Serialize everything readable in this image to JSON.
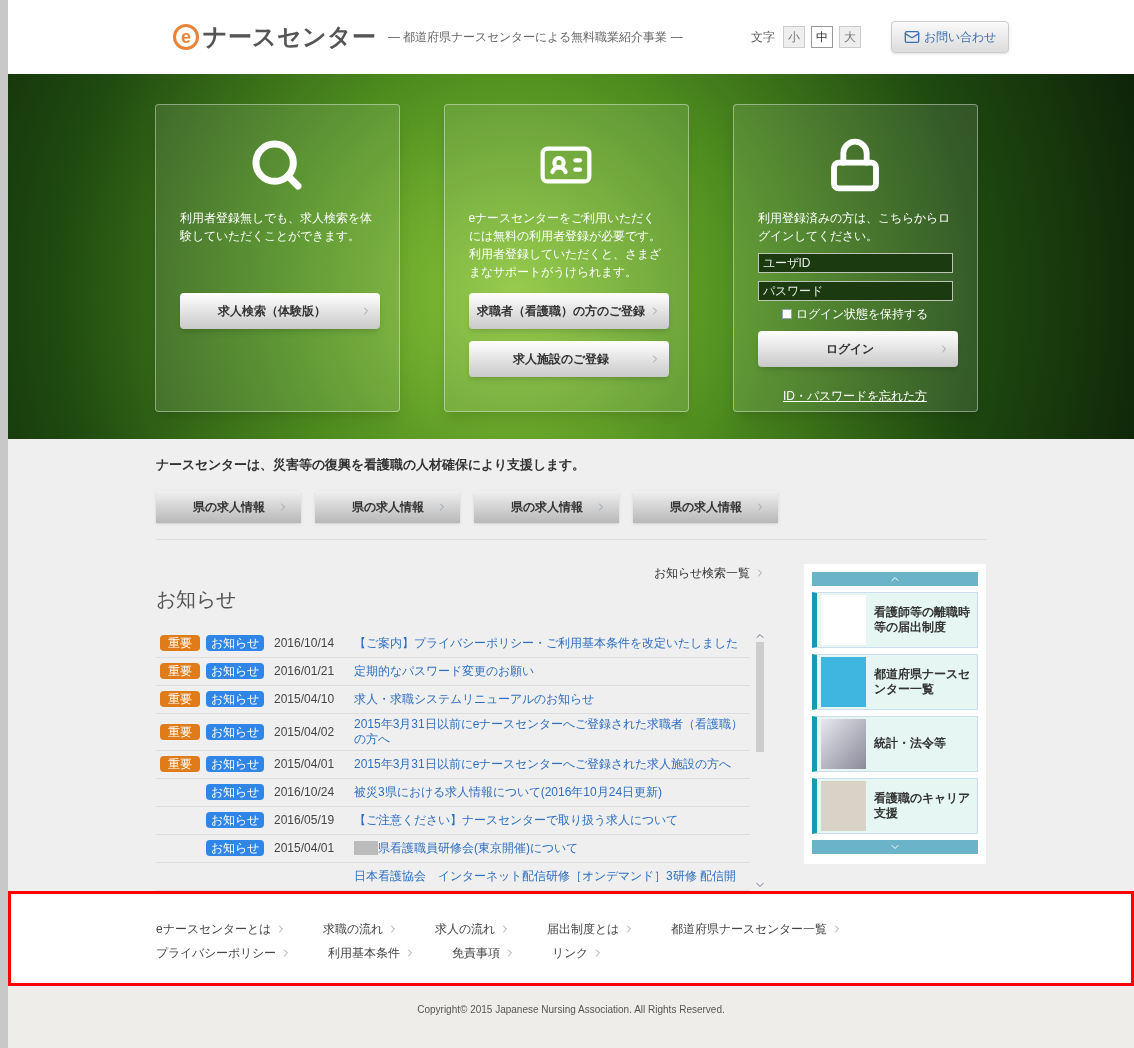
{
  "header": {
    "logo_letter": "e",
    "logo_text": "ナースセンター",
    "tagline": "― 都道府県ナースセンターによる無料職業紹介事業 ―",
    "font_size_label": "文字",
    "font_sizes": [
      {
        "label": "小",
        "selected": false
      },
      {
        "label": "中",
        "selected": true
      },
      {
        "label": "大",
        "selected": false
      }
    ],
    "contact_button": "お問い合わせ"
  },
  "hero": {
    "cards": [
      {
        "kind": "search",
        "text": "利用者登録無しでも、求人検索を体験していただくことができます。",
        "buttons": [
          "求人検索（体験版）"
        ]
      },
      {
        "kind": "register",
        "text": "eナースセンターをご利用いただくには無料の利用者登録が必要です。利用者登録していただくと、さまざまなサポートがうけられます。",
        "buttons": [
          "求職者（看護職）の方のご登録",
          "求人施設のご登録"
        ]
      },
      {
        "kind": "login",
        "text": "利用登録済みの方は、こちらからログインしてください。",
        "user_placeholder": "ユーザID",
        "password_placeholder": "パスワード",
        "remember": {
          "label": "ログイン状態を保持する",
          "checked": false
        },
        "buttons": [
          "ログイン"
        ],
        "forgot_link": "ID・パスワードを忘れた方"
      }
    ]
  },
  "headline": "ナースセンターは、災害等の復興を看護職の人材確保により支援します。",
  "prefecture_buttons": [
    "県の求人情報",
    "県の求人情報",
    "県の求人情報",
    "県の求人情報"
  ],
  "news": {
    "title": "お知らせ",
    "list_link": "お知らせ検索一覧",
    "rows": [
      {
        "tags": [
          {
            "kind": "important",
            "label": "重要"
          },
          {
            "kind": "notice",
            "label": "お知らせ"
          }
        ],
        "date": "2016/10/14",
        "text": "【ご案内】プライバシーポリシー・ご利用基本条件を改定いたしました"
      },
      {
        "tags": [
          {
            "kind": "important",
            "label": "重要"
          },
          {
            "kind": "notice",
            "label": "お知らせ"
          }
        ],
        "date": "2016/01/21",
        "text": "定期的なパスワード変更のお願い"
      },
      {
        "tags": [
          {
            "kind": "important",
            "label": "重要"
          },
          {
            "kind": "notice",
            "label": "お知らせ"
          }
        ],
        "date": "2015/04/10",
        "text": "求人・求職システムリニューアルのお知らせ"
      },
      {
        "tags": [
          {
            "kind": "important",
            "label": "重要"
          },
          {
            "kind": "notice",
            "label": "お知らせ"
          }
        ],
        "date": "2015/04/02",
        "text": "2015年3月31日以前にeナースセンターへご登録された求職者（看護職）の方へ"
      },
      {
        "tags": [
          {
            "kind": "important",
            "label": "重要"
          },
          {
            "kind": "notice",
            "label": "お知らせ"
          }
        ],
        "date": "2015/04/01",
        "text": "2015年3月31日以前にeナースセンターへご登録された求人施設の方へ"
      },
      {
        "tags": [
          {
            "kind": "notice",
            "label": "お知らせ"
          }
        ],
        "date": "2016/10/24",
        "text": "被災3県における求人情報について(2016年10月24日更新)"
      },
      {
        "tags": [
          {
            "kind": "notice",
            "label": "お知らせ"
          }
        ],
        "date": "2016/05/19",
        "text": "【ご注意ください】ナースセンターで取り扱う求人について"
      },
      {
        "tags": [
          {
            "kind": "notice",
            "label": "お知らせ"
          }
        ],
        "date": "2015/04/01",
        "redacted": true,
        "text": "県看護職員研修会(東京開催)について"
      },
      {
        "tags": [],
        "date": "",
        "text": "日本看護協会　インターネット配信研修［オンデマンド］3研修 配信開"
      }
    ]
  },
  "side_banners": [
    {
      "kind": "logo",
      "text": "看護師等の離職時等の届出制度"
    },
    {
      "kind": "map",
      "text": "都道府県ナースセンター一覧"
    },
    {
      "kind": "books",
      "text": "統計・法令等"
    },
    {
      "kind": "person",
      "text": "看護職のキャリア支援"
    }
  ],
  "footer": {
    "links": [
      "eナースセンターとは",
      "求職の流れ",
      "求人の流れ",
      "届出制度とは",
      "都道府県ナースセンター一覧",
      "プライバシーポリシー",
      "利用基本条件",
      "免責事項",
      "リンク"
    ],
    "copyright": "Copyright© 2015 Japanese Nursing Association. All Rights Reserved."
  }
}
